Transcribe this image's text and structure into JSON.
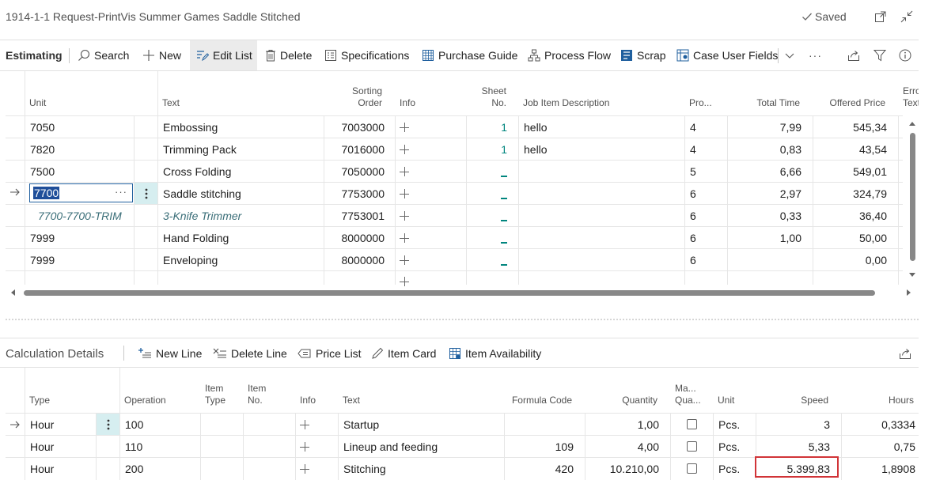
{
  "header": {
    "title": "1914-1-1 Request-PrintVis Summer Games Saddle Stitched",
    "saved_label": "Saved"
  },
  "toolbar": {
    "title": "Estimating",
    "search": "Search",
    "new": "New",
    "edit_list": "Edit List",
    "delete": "Delete",
    "specifications": "Specifications",
    "purchase_guide": "Purchase Guide",
    "process_flow": "Process Flow",
    "scrap": "Scrap",
    "case_user_fields": "Case User Fields",
    "more": "···"
  },
  "estimating": {
    "headers": {
      "unit": "Unit",
      "text": "Text",
      "sorting_order_1": "Sorting",
      "sorting_order_2": "Order",
      "info": "Info",
      "sheet_no_1": "Sheet",
      "sheet_no_2": "No.",
      "job_item_description": "Job Item Description",
      "pro": "Pro...",
      "total_time": "Total Time",
      "offered_price": "Offered Price",
      "error_1": "Erro",
      "error_2": "Text"
    },
    "rows": [
      {
        "unit": "7050",
        "text": "Embossing",
        "sorting": "7003000",
        "sheet": "1",
        "desc": "hello",
        "pro": "4",
        "total_time": "7,99",
        "price": "545,34"
      },
      {
        "unit": "7820",
        "text": "Trimming Pack",
        "sorting": "7016000",
        "sheet": "1",
        "desc": "hello",
        "pro": "4",
        "total_time": "0,83",
        "price": "43,54"
      },
      {
        "unit": "7500",
        "text": "Cross Folding",
        "sorting": "7050000",
        "sheet": "_",
        "desc": "",
        "pro": "5",
        "total_time": "6,66",
        "price": "549,01"
      },
      {
        "unit": "7700",
        "text": "Saddle stitching",
        "sorting": "7753000",
        "sheet": "_",
        "desc": "",
        "pro": "6",
        "total_time": "2,97",
        "price": "324,79"
      },
      {
        "unit": "7700-7700-TRIM",
        "text": "3-Knife Trimmer",
        "sorting": "7753001",
        "sheet": "_",
        "desc": "",
        "pro": "6",
        "total_time": "0,33",
        "price": "36,40"
      },
      {
        "unit": "7999",
        "text": "Hand Folding",
        "sorting": "8000000",
        "sheet": "_",
        "desc": "",
        "pro": "6",
        "total_time": "1,00",
        "price": "50,00"
      },
      {
        "unit": "7999",
        "text": "Enveloping",
        "sorting": "8000000",
        "sheet": "_",
        "desc": "",
        "pro": "6",
        "total_time": "",
        "price": "0,00"
      }
    ],
    "selected_row_menu": "···"
  },
  "calc": {
    "title": "Calculation Details",
    "new_line": "New Line",
    "delete_line": "Delete Line",
    "price_list": "Price List",
    "item_card": "Item Card",
    "item_availability": "Item Availability",
    "headers": {
      "type": "Type",
      "operation": "Operation",
      "item_type_1": "Item",
      "item_type_2": "Type",
      "item_no_1": "Item",
      "item_no_2": "No.",
      "info": "Info",
      "text": "Text",
      "formula_code": "Formula Code",
      "quantity": "Quantity",
      "ma_1": "Ma...",
      "ma_2": "Qua...",
      "unit": "Unit",
      "speed": "Speed",
      "hours": "Hours"
    },
    "rows": [
      {
        "type": "Hour",
        "operation": "100",
        "text": "Startup",
        "formula": "",
        "quantity": "1,00",
        "unit": "Pcs.",
        "speed": "3",
        "hours": "0,3334"
      },
      {
        "type": "Hour",
        "operation": "110",
        "text": "Lineup and feeding",
        "formula": "109",
        "quantity": "4,00",
        "unit": "Pcs.",
        "speed": "5,33",
        "hours": "0,75"
      },
      {
        "type": "Hour",
        "operation": "200",
        "text": "Stitching",
        "formula": "420",
        "quantity": "10.210,00",
        "unit": "Pcs.",
        "speed": "5.399,83",
        "hours": "1,8908"
      }
    ]
  },
  "colors": {
    "accent": "#00857e",
    "highlight_box": "#d13438",
    "selected_cell_bg": "#1f4e99"
  }
}
